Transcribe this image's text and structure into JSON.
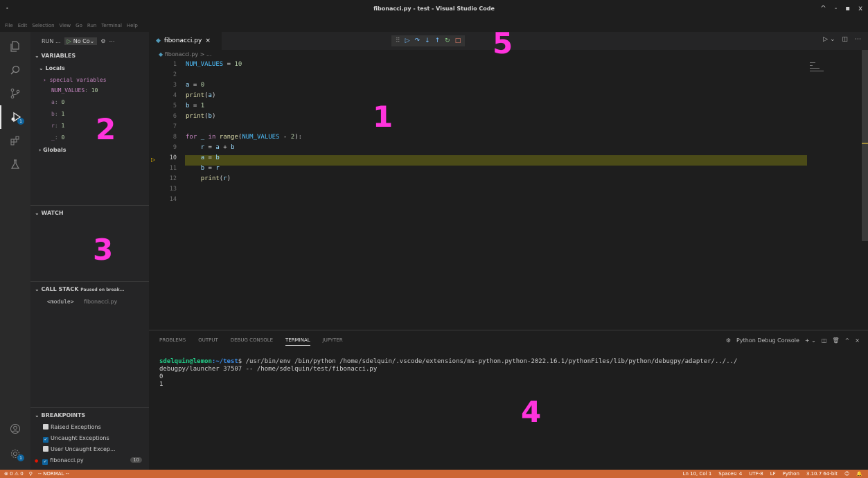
{
  "window": {
    "title": "fibonacci.py - test - Visual Studio Code",
    "controls": [
      "^",
      "-",
      "▪",
      "x"
    ]
  },
  "menu": [
    "File",
    "Edit",
    "Selection",
    "View",
    "Go",
    "Run",
    "Terminal",
    "Help"
  ],
  "activity_bar": {
    "items": [
      "explorer-icon",
      "search-icon",
      "source-control-icon",
      "run-debug-icon",
      "extensions-icon",
      "testing-icon"
    ],
    "bottom": [
      "accounts-icon",
      "manage-gear-icon"
    ],
    "debug_badge": "1",
    "gear_badge": "1"
  },
  "sidebar": {
    "run_label": "RUN ...",
    "config": "No Co",
    "variables_title": "VARIABLES",
    "locals_title": "Locals",
    "special_vars": "special variables",
    "locals": [
      {
        "name": "NUM_VALUES",
        "value": "10"
      },
      {
        "name": "a",
        "value": "0"
      },
      {
        "name": "b",
        "value": "1"
      },
      {
        "name": "r",
        "value": "1"
      },
      {
        "name": "_",
        "value": "0"
      }
    ],
    "globals_title": "Globals",
    "watch_title": "WATCH",
    "callstack_title": "CALL STACK",
    "callstack_status": "Paused on break...",
    "frames": [
      {
        "name": "<module>",
        "file": "fibonacci.py"
      }
    ],
    "breakpoints_title": "BREAKPOINTS",
    "breakpoints": [
      {
        "label": "Raised Exceptions",
        "checked": false
      },
      {
        "label": "Uncaught Exceptions",
        "checked": true
      },
      {
        "label": "User Uncaught Excep...",
        "checked": false
      },
      {
        "label": "fibonacci.py",
        "checked": true,
        "count": "10"
      }
    ]
  },
  "editor": {
    "tab": "fibonacci.py",
    "breadcrumb": "fibonacci.py > ...",
    "current_line": "10",
    "line_numbers": [
      "1",
      "2",
      "3",
      "4",
      "5",
      "6",
      "7",
      "8",
      "9",
      "10",
      "11",
      "12",
      "13",
      "14"
    ]
  },
  "debug_toolbar": [
    "⠿",
    "▷",
    "↷",
    "↓",
    "↑",
    "↻",
    "□"
  ],
  "panel": {
    "tabs": [
      "PROBLEMS",
      "OUTPUT",
      "DEBUG CONSOLE",
      "TERMINAL",
      "JUPYTER"
    ],
    "active_tab": "TERMINAL",
    "terminal_name": "Python Debug Console",
    "prompt_user": "sdelquin@lemon",
    "prompt_path": ":~/test",
    "prompt_symbol": "$",
    "command_line1": " /usr/bin/env /bin/python /home/sdelquin/.vscode/extensions/ms-python.python-2022.16.1/pythonFiles/lib/python/debugpy/adapter/../../",
    "command_line2": "debugpy/launcher 37507 -- /home/sdelquin/test/fibonacci.py",
    "output": [
      "0",
      "1"
    ]
  },
  "statusbar": {
    "problems": "⊗ 0 ⚠ 0",
    "mode": "-- NORMAL --",
    "position": "Ln 10, Col 1",
    "spaces": "Spaces: 4",
    "encoding": "UTF-8",
    "eol": "LF",
    "language": "Python",
    "interpreter": "3.10.7 64-bit"
  },
  "annotations": [
    "1",
    "2",
    "3",
    "4",
    "5"
  ]
}
